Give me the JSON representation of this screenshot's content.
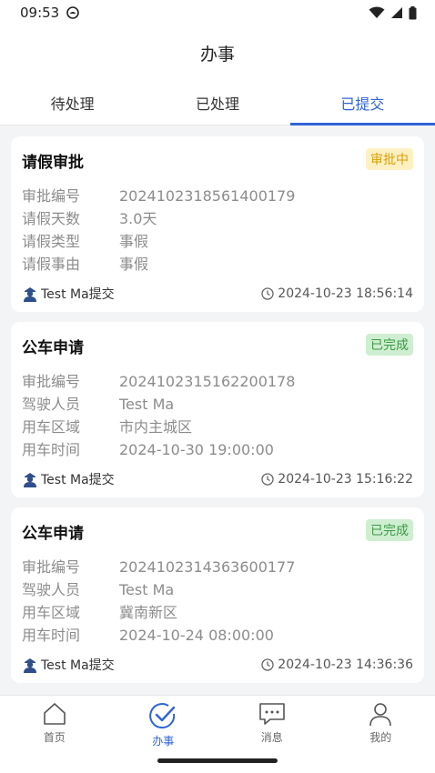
{
  "status": {
    "time": "09:53"
  },
  "header": {
    "title": "办事"
  },
  "tabs": [
    {
      "label": "待处理"
    },
    {
      "label": "已处理"
    },
    {
      "label": "已提交"
    }
  ],
  "cards": [
    {
      "title": "请假审批",
      "badge": "审批中",
      "rows": [
        {
          "label": "审批编号",
          "value": "2024102318561400179"
        },
        {
          "label": "请假天数",
          "value": "3.0天"
        },
        {
          "label": "请假类型",
          "value": "事假"
        },
        {
          "label": "请假事由",
          "value": "事假"
        }
      ],
      "submitter": "Test Ma提交",
      "time": "2024-10-23 18:56:14"
    },
    {
      "title": "公车申请",
      "badge": "已完成",
      "rows": [
        {
          "label": "审批编号",
          "value": "2024102315162200178"
        },
        {
          "label": "驾驶人员",
          "value": "Test Ma"
        },
        {
          "label": "用车区域",
          "value": "市内主城区"
        },
        {
          "label": "用车时间",
          "value": "2024-10-30 19:00:00"
        }
      ],
      "submitter": "Test Ma提交",
      "time": "2024-10-23 15:16:22"
    },
    {
      "title": "公车申请",
      "badge": "已完成",
      "rows": [
        {
          "label": "审批编号",
          "value": "2024102314363600177"
        },
        {
          "label": "驾驶人员",
          "value": "Test Ma"
        },
        {
          "label": "用车区域",
          "value": "冀南新区"
        },
        {
          "label": "用车时间",
          "value": "2024-10-24 08:00:00"
        }
      ],
      "submitter": "Test Ma提交",
      "time": "2024-10-23 14:36:36"
    }
  ],
  "nav": [
    {
      "label": "首页"
    },
    {
      "label": "办事"
    },
    {
      "label": "消息"
    },
    {
      "label": "我的"
    }
  ],
  "colors": {
    "accent": "#2f63d6",
    "pending": "#d9a006",
    "done": "#3a9a45"
  }
}
